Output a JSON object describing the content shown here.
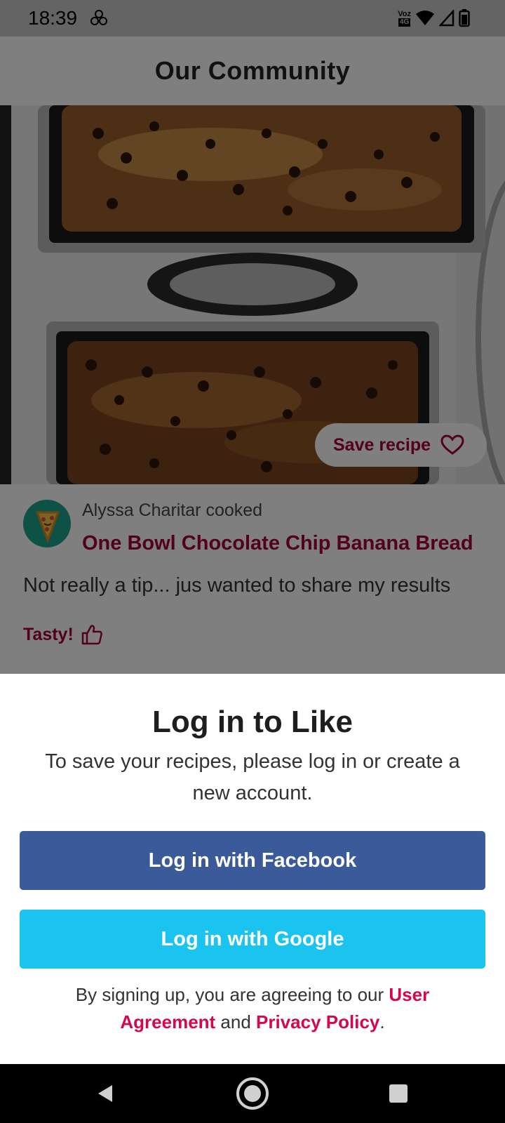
{
  "status_bar": {
    "time": "18:39",
    "carrier_top": "Voz",
    "carrier_bottom": "4G",
    "icons": [
      "pinwheel-icon",
      "wifi-icon",
      "signal-icon",
      "battery-icon"
    ]
  },
  "header": {
    "title": "Our Community"
  },
  "photo": {
    "save_label": "Save recipe"
  },
  "tip": {
    "cook_line": "Alyssa Charitar cooked",
    "recipe_name": "One Bowl Chocolate Chip Banana Bread",
    "text": "Not really a tip... jus wanted to share my results",
    "reaction_label": "Tasty!"
  },
  "login_sheet": {
    "title": "Log in to Like",
    "body": "To save your recipes, please log in or create a new account.",
    "facebook_label": "Log in with Facebook",
    "google_label": "Log in with Google",
    "legal_prefix": "By signing up, you are agreeing to our ",
    "user_agreement": "User Agreement",
    "legal_and": " and ",
    "privacy_policy": "Privacy Policy",
    "legal_suffix": "."
  },
  "colors": {
    "accent": "#a6003f",
    "link": "#d6064f",
    "facebook": "#3b5a9a",
    "google": "#1ac4ef"
  }
}
